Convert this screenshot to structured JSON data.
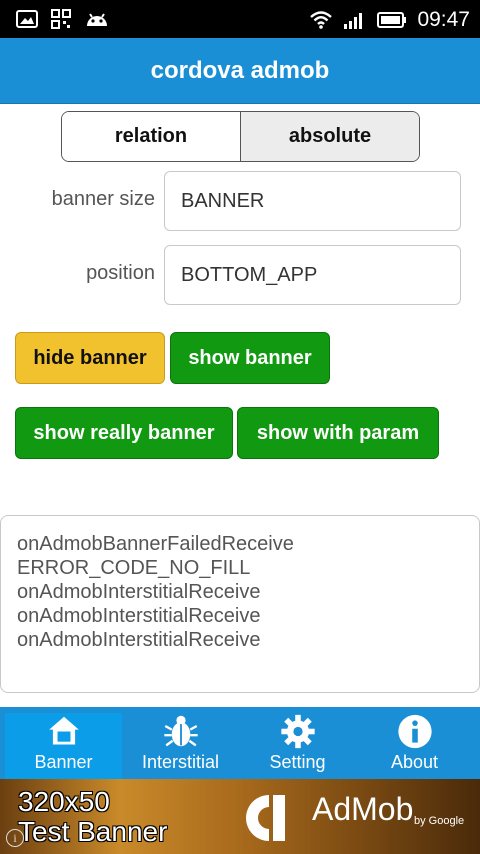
{
  "status_bar": {
    "time": "09:47"
  },
  "header": {
    "title": "cordova admob"
  },
  "segment": {
    "relation_label": "relation",
    "absolute_label": "absolute"
  },
  "form": {
    "banner_size_label": "banner size",
    "banner_size_value": "BANNER",
    "position_label": "position",
    "position_value": "BOTTOM_APP"
  },
  "buttons": {
    "hide_banner": "hide banner",
    "show_banner": "show banner",
    "show_really_banner": "show really banner",
    "show_with_param": "show with param"
  },
  "log": {
    "lines": [
      "onAdmobBannerFailedReceive",
      "ERROR_CODE_NO_FILL",
      "onAdmobInterstitialReceive",
      "onAdmobInterstitialReceive",
      "onAdmobInterstitialReceive"
    ]
  },
  "tabs": [
    {
      "label": "Banner",
      "icon": "home-icon",
      "active": true
    },
    {
      "label": "Interstitial",
      "icon": "bug-icon",
      "active": false
    },
    {
      "label": "Setting",
      "icon": "gear-icon",
      "active": false
    },
    {
      "label": "About",
      "icon": "info-icon",
      "active": false
    }
  ],
  "ad": {
    "line1": "320x50",
    "line2": "Test Banner",
    "brand": "AdMob",
    "by": "by Google"
  },
  "colors": {
    "header": "#1a8fd6",
    "green": "#119a11",
    "yellow": "#f2c12e"
  }
}
